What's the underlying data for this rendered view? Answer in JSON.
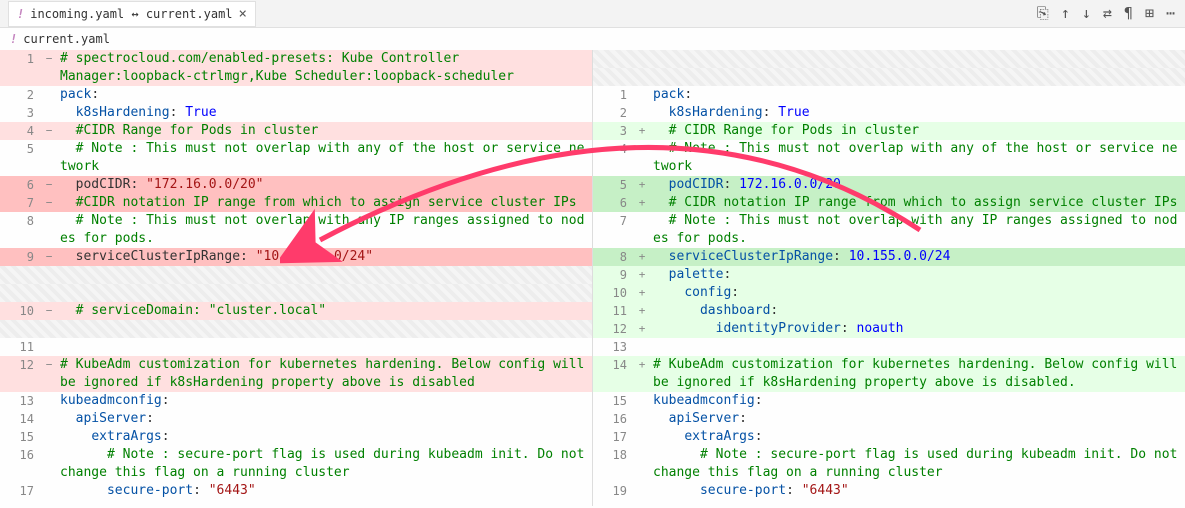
{
  "tab": {
    "title": "incoming.yaml ↔ current.yaml"
  },
  "subheader": {
    "file": "current.yaml"
  },
  "toolbar_icons": [
    "⎘",
    "↑",
    "↓",
    "⇄",
    "¶",
    "⊞",
    "⋯"
  ],
  "left": {
    "lines": [
      {
        "n": "1",
        "m": "−",
        "bg": "bg-del",
        "spans": [
          {
            "cls": "c-comment",
            "t": "# spectrocloud.com/enabled-presets: Kube Controller"
          }
        ]
      },
      {
        "n": "",
        "m": "",
        "bg": "bg-del",
        "spans": [
          {
            "cls": "c-comment",
            "t": "Manager:loopback-ctrlmgr,Kube Scheduler:loopback-scheduler"
          }
        ]
      },
      {
        "n": "2",
        "m": "",
        "bg": "",
        "spans": [
          {
            "cls": "c-key",
            "t": "pack"
          },
          {
            "cls": "c-punc",
            "t": ":"
          }
        ]
      },
      {
        "n": "3",
        "m": "",
        "bg": "",
        "spans": [
          {
            "cls": "",
            "t": "  "
          },
          {
            "cls": "c-key",
            "t": "k8sHardening"
          },
          {
            "cls": "c-punc",
            "t": ": "
          },
          {
            "cls": "c-bool",
            "t": "True"
          }
        ]
      },
      {
        "n": "4",
        "m": "−",
        "bg": "bg-del",
        "spans": [
          {
            "cls": "",
            "t": "  "
          },
          {
            "cls": "c-comment",
            "t": "#CIDR Range for Pods in cluster"
          }
        ]
      },
      {
        "n": "5",
        "m": "",
        "bg": "",
        "spans": [
          {
            "cls": "",
            "t": "  "
          },
          {
            "cls": "c-comment",
            "t": "# Note : This must not overlap with any of the host or service network"
          }
        ]
      },
      {
        "n": "6",
        "m": "−",
        "bg": "bg-del-strong",
        "spans": [
          {
            "cls": "",
            "t": "  "
          },
          {
            "cls": "c-key-r",
            "t": "podCIDR"
          },
          {
            "cls": "c-punc",
            "t": ": "
          },
          {
            "cls": "c-string",
            "t": "\"172.16.0.0/20\""
          }
        ]
      },
      {
        "n": "7",
        "m": "−",
        "bg": "bg-del-strong",
        "spans": [
          {
            "cls": "",
            "t": "  "
          },
          {
            "cls": "c-comment",
            "t": "#CIDR notation IP range from which to assign service cluster IPs"
          }
        ]
      },
      {
        "n": "8",
        "m": "",
        "bg": "",
        "spans": [
          {
            "cls": "",
            "t": "  "
          },
          {
            "cls": "c-comment",
            "t": "# Note : This must not overlap with any IP ranges assigned to nodes for pods."
          }
        ]
      },
      {
        "n": "9",
        "m": "−",
        "bg": "bg-del-strong",
        "spans": [
          {
            "cls": "",
            "t": "  "
          },
          {
            "cls": "c-key-r",
            "t": "serviceClusterIpRange"
          },
          {
            "cls": "c-punc",
            "t": ": "
          },
          {
            "cls": "c-string",
            "t": "\"10.155.0.0/24\""
          }
        ]
      },
      {
        "n": "",
        "m": "",
        "bg": "bg-hatch-del",
        "spans": [
          {
            "cls": "",
            "t": " "
          }
        ]
      },
      {
        "n": "",
        "m": "",
        "bg": "bg-hatch-del",
        "spans": [
          {
            "cls": "",
            "t": " "
          }
        ]
      },
      {
        "n": "10",
        "m": "−",
        "bg": "bg-del",
        "spans": [
          {
            "cls": "",
            "t": "  "
          },
          {
            "cls": "c-comment",
            "t": "# serviceDomain: \"cluster.local\""
          }
        ]
      },
      {
        "n": "",
        "m": "",
        "bg": "bg-hatch-del",
        "spans": [
          {
            "cls": "",
            "t": " "
          }
        ]
      },
      {
        "n": "11",
        "m": "",
        "bg": "",
        "spans": [
          {
            "cls": "",
            "t": ""
          }
        ]
      },
      {
        "n": "12",
        "m": "−",
        "bg": "bg-del",
        "spans": [
          {
            "cls": "c-comment",
            "t": "# KubeAdm customization for kubernetes hardening. Below config will be ignored if k8sHardening property above is disabled"
          }
        ]
      },
      {
        "n": "13",
        "m": "",
        "bg": "",
        "spans": [
          {
            "cls": "c-key",
            "t": "kubeadmconfig"
          },
          {
            "cls": "c-punc",
            "t": ":"
          }
        ]
      },
      {
        "n": "14",
        "m": "",
        "bg": "",
        "spans": [
          {
            "cls": "",
            "t": "  "
          },
          {
            "cls": "c-key",
            "t": "apiServer"
          },
          {
            "cls": "c-punc",
            "t": ":"
          }
        ]
      },
      {
        "n": "15",
        "m": "",
        "bg": "",
        "spans": [
          {
            "cls": "",
            "t": "    "
          },
          {
            "cls": "c-key",
            "t": "extraArgs"
          },
          {
            "cls": "c-punc",
            "t": ":"
          }
        ]
      },
      {
        "n": "16",
        "m": "",
        "bg": "",
        "spans": [
          {
            "cls": "",
            "t": "      "
          },
          {
            "cls": "c-comment",
            "t": "# Note : secure-port flag is used during kubeadm init. Do not change this flag on a running cluster"
          }
        ]
      },
      {
        "n": "17",
        "m": "",
        "bg": "",
        "spans": [
          {
            "cls": "",
            "t": "      "
          },
          {
            "cls": "c-key",
            "t": "secure-port"
          },
          {
            "cls": "c-punc",
            "t": ": "
          },
          {
            "cls": "c-string",
            "t": "\"6443\""
          }
        ]
      }
    ]
  },
  "right": {
    "lines": [
      {
        "n": "",
        "m": "",
        "bg": "bg-hatch-add",
        "spans": [
          {
            "cls": "",
            "t": " "
          }
        ]
      },
      {
        "n": "",
        "m": "",
        "bg": "bg-hatch-add",
        "spans": [
          {
            "cls": "",
            "t": " "
          }
        ]
      },
      {
        "n": "1",
        "m": "",
        "bg": "",
        "spans": [
          {
            "cls": "c-key",
            "t": "pack"
          },
          {
            "cls": "c-punc",
            "t": ":"
          }
        ]
      },
      {
        "n": "2",
        "m": "",
        "bg": "",
        "spans": [
          {
            "cls": "",
            "t": "  "
          },
          {
            "cls": "c-key",
            "t": "k8sHardening"
          },
          {
            "cls": "c-punc",
            "t": ": "
          },
          {
            "cls": "c-bool",
            "t": "True"
          }
        ]
      },
      {
        "n": "3",
        "m": "+",
        "bg": "bg-add",
        "spans": [
          {
            "cls": "",
            "t": "  "
          },
          {
            "cls": "c-comment",
            "t": "# CIDR Range for Pods in cluster"
          }
        ]
      },
      {
        "n": "4",
        "m": "",
        "bg": "",
        "spans": [
          {
            "cls": "",
            "t": "  "
          },
          {
            "cls": "c-comment",
            "t": "# Note : This must not overlap with any of the host or service network"
          }
        ]
      },
      {
        "n": "5",
        "m": "+",
        "bg": "bg-add-strong",
        "spans": [
          {
            "cls": "",
            "t": "  "
          },
          {
            "cls": "c-key",
            "t": "podCIDR"
          },
          {
            "cls": "c-punc",
            "t": ": "
          },
          {
            "cls": "c-bool",
            "t": "172.16.0.0/20"
          }
        ]
      },
      {
        "n": "6",
        "m": "+",
        "bg": "bg-add-strong",
        "spans": [
          {
            "cls": "",
            "t": "  "
          },
          {
            "cls": "c-comment",
            "t": "# CIDR notation IP range from which to assign service cluster IPs"
          }
        ]
      },
      {
        "n": "7",
        "m": "",
        "bg": "",
        "spans": [
          {
            "cls": "",
            "t": "  "
          },
          {
            "cls": "c-comment",
            "t": "# Note : This must not overlap with any IP ranges assigned to nodes for pods."
          }
        ]
      },
      {
        "n": "8",
        "m": "+",
        "bg": "bg-add-strong",
        "spans": [
          {
            "cls": "",
            "t": "  "
          },
          {
            "cls": "c-key",
            "t": "serviceClusterIpRange"
          },
          {
            "cls": "c-punc",
            "t": ": "
          },
          {
            "cls": "c-bool",
            "t": "10.155.0.0/24"
          }
        ]
      },
      {
        "n": "9",
        "m": "+",
        "bg": "bg-add",
        "spans": [
          {
            "cls": "",
            "t": "  "
          },
          {
            "cls": "c-key",
            "t": "palette"
          },
          {
            "cls": "c-punc",
            "t": ":"
          }
        ]
      },
      {
        "n": "10",
        "m": "+",
        "bg": "bg-add",
        "spans": [
          {
            "cls": "",
            "t": "    "
          },
          {
            "cls": "c-key",
            "t": "config"
          },
          {
            "cls": "c-punc",
            "t": ":"
          }
        ]
      },
      {
        "n": "11",
        "m": "+",
        "bg": "bg-add",
        "spans": [
          {
            "cls": "",
            "t": "      "
          },
          {
            "cls": "c-key",
            "t": "dashboard"
          },
          {
            "cls": "c-punc",
            "t": ":"
          }
        ]
      },
      {
        "n": "12",
        "m": "+",
        "bg": "bg-add",
        "spans": [
          {
            "cls": "",
            "t": "        "
          },
          {
            "cls": "c-key",
            "t": "identityProvider"
          },
          {
            "cls": "c-punc",
            "t": ": "
          },
          {
            "cls": "c-bool",
            "t": "noauth"
          }
        ]
      },
      {
        "n": "13",
        "m": "",
        "bg": "",
        "spans": [
          {
            "cls": "",
            "t": ""
          }
        ]
      },
      {
        "n": "14",
        "m": "+",
        "bg": "bg-add",
        "spans": [
          {
            "cls": "c-comment",
            "t": "# KubeAdm customization for kubernetes hardening. Below config will be ignored if k8sHardening property above is disabled."
          }
        ]
      },
      {
        "n": "15",
        "m": "",
        "bg": "",
        "spans": [
          {
            "cls": "c-key",
            "t": "kubeadmconfig"
          },
          {
            "cls": "c-punc",
            "t": ":"
          }
        ]
      },
      {
        "n": "16",
        "m": "",
        "bg": "",
        "spans": [
          {
            "cls": "",
            "t": "  "
          },
          {
            "cls": "c-key",
            "t": "apiServer"
          },
          {
            "cls": "c-punc",
            "t": ":"
          }
        ]
      },
      {
        "n": "17",
        "m": "",
        "bg": "",
        "spans": [
          {
            "cls": "",
            "t": "    "
          },
          {
            "cls": "c-key",
            "t": "extraArgs"
          },
          {
            "cls": "c-punc",
            "t": ":"
          }
        ]
      },
      {
        "n": "18",
        "m": "",
        "bg": "",
        "spans": [
          {
            "cls": "",
            "t": "      "
          },
          {
            "cls": "c-comment",
            "t": "# Note : secure-port flag is used during kubeadm init. Do not change this flag on a running cluster"
          }
        ]
      },
      {
        "n": "19",
        "m": "",
        "bg": "",
        "spans": [
          {
            "cls": "",
            "t": "      "
          },
          {
            "cls": "c-key",
            "t": "secure-port"
          },
          {
            "cls": "c-punc",
            "t": ": "
          },
          {
            "cls": "c-string",
            "t": "\"6443\""
          }
        ]
      }
    ]
  }
}
